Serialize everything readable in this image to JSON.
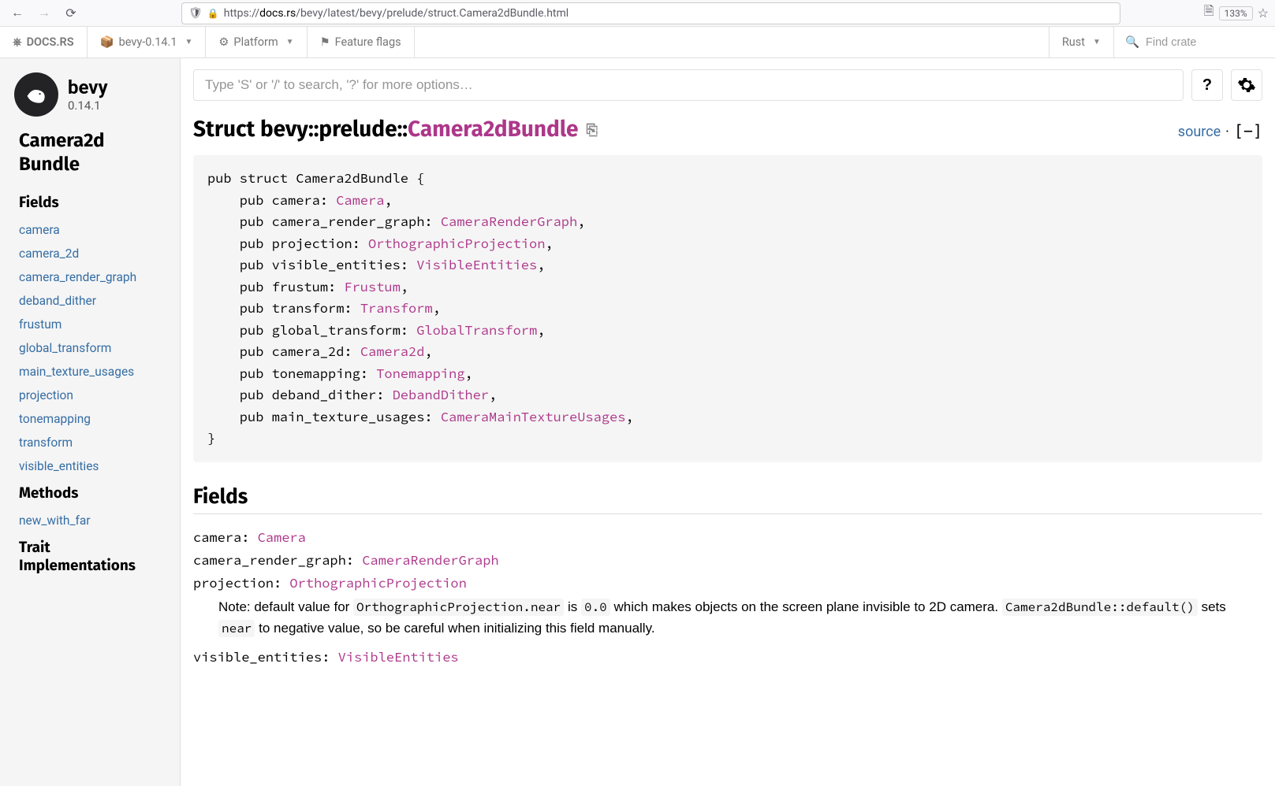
{
  "browser": {
    "url_prefix": "https://",
    "url_domain": "docs.rs",
    "url_path": "/bevy/latest/bevy/prelude/struct.Camera2dBundle.html",
    "zoom": "133%"
  },
  "docsrs": {
    "home": "DOCS.RS",
    "crate": "bevy-0.14.1",
    "platform": "Platform",
    "feature_flags": "Feature flags",
    "rust": "Rust",
    "search_placeholder": "Find crate"
  },
  "sidebar": {
    "crate_name": "bevy",
    "crate_version": "0.14.1",
    "location": "Camera2d Bundle",
    "fields_heading": "Fields",
    "fields": [
      "camera",
      "camera_2d",
      "camera_render_graph",
      "deband_dither",
      "frustum",
      "global_transform",
      "main_texture_usages",
      "projection",
      "tonemapping",
      "transform",
      "visible_entities"
    ],
    "methods_heading": "Methods",
    "methods": [
      "new_with_far"
    ],
    "traits_heading": "Trait Implementations"
  },
  "search": {
    "placeholder": "Type 'S' or '/' to search, '?' for more options…",
    "help": "?"
  },
  "heading": {
    "kind": "Struct ",
    "path": "bevy::prelude::",
    "name": "Camera2dBundle",
    "source": "source",
    "sep": " · ",
    "toggle": "[−]"
  },
  "decl": {
    "open": "pub struct Camera2dBundle {",
    "fields": [
      {
        "name": "camera",
        "type": "Camera"
      },
      {
        "name": "camera_render_graph",
        "type": "CameraRenderGraph"
      },
      {
        "name": "projection",
        "type": "OrthographicProjection"
      },
      {
        "name": "visible_entities",
        "type": "VisibleEntities"
      },
      {
        "name": "frustum",
        "type": "Frustum"
      },
      {
        "name": "transform",
        "type": "Transform"
      },
      {
        "name": "global_transform",
        "type": "GlobalTransform"
      },
      {
        "name": "camera_2d",
        "type": "Camera2d"
      },
      {
        "name": "tonemapping",
        "type": "Tonemapping"
      },
      {
        "name": "deband_dither",
        "type": "DebandDither"
      },
      {
        "name": "main_texture_usages",
        "type": "CameraMainTextureUsages"
      }
    ],
    "close": "}"
  },
  "fields_section": {
    "heading": "Fields",
    "items": [
      {
        "name": "camera",
        "type": "Camera"
      },
      {
        "name": "camera_render_graph",
        "type": "CameraRenderGraph"
      },
      {
        "name": "projection",
        "type": "OrthographicProjection",
        "note_parts": [
          "Note: default value for ",
          "OrthographicProjection.near",
          " is ",
          "0.0",
          " which makes objects on the screen plane invisible to 2D camera. ",
          "Camera2dBundle::default()",
          " sets ",
          "near",
          " to negative value, so be careful when initializing this field manually."
        ]
      },
      {
        "name": "visible_entities",
        "type": "VisibleEntities"
      }
    ]
  }
}
